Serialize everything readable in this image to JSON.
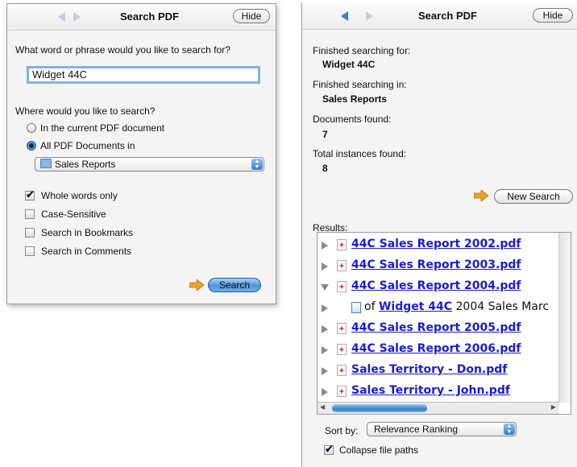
{
  "left": {
    "title": "Search PDF",
    "hide_label": "Hide",
    "question": "What word or phrase would you like to search for?",
    "query": "Widget 44C",
    "where_label": "Where would you like to search?",
    "radio_current": "In the current PDF document",
    "radio_all": "All PDF Documents in",
    "location": "Sales Reports",
    "options": [
      {
        "label": "Whole words only",
        "checked": true
      },
      {
        "label": "Case-Sensitive",
        "checked": false
      },
      {
        "label": "Search in Bookmarks",
        "checked": false
      },
      {
        "label": "Search in Comments",
        "checked": false
      }
    ],
    "search_button": "Search"
  },
  "right": {
    "title": "Search PDF",
    "hide_label": "Hide",
    "searched_for_label": "Finished searching for:",
    "searched_for_value": "Widget 44C",
    "searched_in_label": "Finished searching in:",
    "searched_in_value": "Sales Reports",
    "docs_label": "Documents found:",
    "docs_value": "7",
    "instances_label": "Total instances found:",
    "instances_value": "8",
    "new_search_button": "New Search",
    "results_label": "Results:",
    "results": [
      {
        "file": "44C Sales Report 2002.pdf"
      },
      {
        "file": "44C Sales Report 2003.pdf"
      },
      {
        "file": "44C Sales Report 2004.pdf",
        "expanded": true
      },
      {
        "hit_prefix": "of",
        "hit_term": "Widget 44C",
        "hit_suffix": "2004 Sales Marc"
      },
      {
        "file": "44C Sales Report 2005.pdf"
      },
      {
        "file": "44C Sales Report 2006.pdf"
      },
      {
        "file": "Sales Territory - Don.pdf"
      },
      {
        "file": "Sales Territory - John.pdf"
      }
    ],
    "sort_label": "Sort by:",
    "sort_value": "Relevance Ranking",
    "collapse_label": "Collapse file paths",
    "collapse_checked": true
  },
  "colors": {
    "accent_blue": "#3b7fc6",
    "link_blue": "#1a1adb",
    "orange_arrow": "#f0a020"
  }
}
